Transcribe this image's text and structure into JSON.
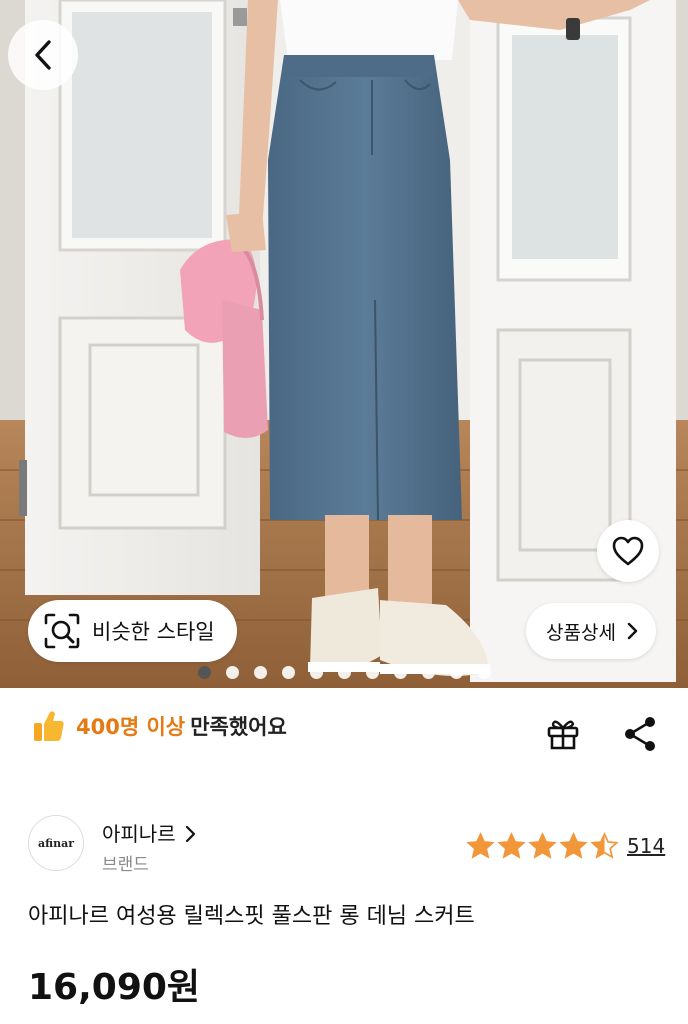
{
  "hero": {
    "back_icon": "chevron-left-icon",
    "similar_style_label": "비슷한 스타일",
    "similar_style_icon": "image-search-icon",
    "detail_label": "상품상세",
    "detail_icon": "chevron-right-icon",
    "wishlist_icon": "heart-outline-icon",
    "carousel": {
      "total": 11,
      "active_index": 0
    }
  },
  "satisfaction": {
    "icon": "thumbs-up-icon",
    "highlight": "400명 이상",
    "rest": "만족했어요",
    "highlight_color": "#e57a14"
  },
  "actions": {
    "gift_icon": "gift-icon",
    "share_icon": "share-icon"
  },
  "brand": {
    "logo_text": "afinar",
    "name": "아피나르",
    "type": "브랜드"
  },
  "rating": {
    "value": 4.5,
    "max": 5,
    "count": "514",
    "star_color": "#f2963a"
  },
  "product": {
    "title": "아피나르 여성용 릴렉스핏 풀스판 롱 데님 스커트",
    "price": "16,090원"
  }
}
